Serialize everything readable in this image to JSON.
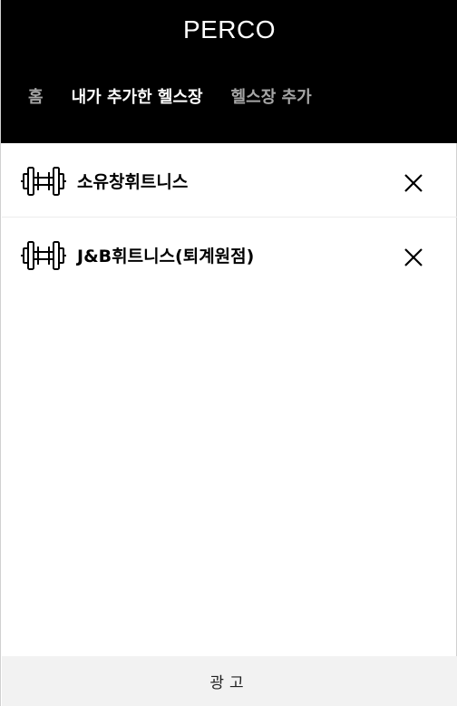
{
  "app": {
    "title": "PERCO"
  },
  "nav": {
    "tabs": [
      {
        "label": "홈",
        "active": false
      },
      {
        "label": "내가 추가한 헬스장",
        "active": true
      },
      {
        "label": "헬스장 추가",
        "active": false
      }
    ]
  },
  "gyms": [
    {
      "name": "소유창휘트니스",
      "icon": "dumbbell-icon",
      "action_icon": "close-icon"
    },
    {
      "name": "J&B휘트니스(퇴계원점)",
      "icon": "dumbbell-icon",
      "action_icon": "close-icon"
    }
  ],
  "footer": {
    "ad_label": "광고"
  },
  "colors": {
    "header_bg": "#000000",
    "active_tab": "#ffffff",
    "inactive_tab": "#a6a6a6",
    "ad_bg": "#f2f2f2"
  }
}
